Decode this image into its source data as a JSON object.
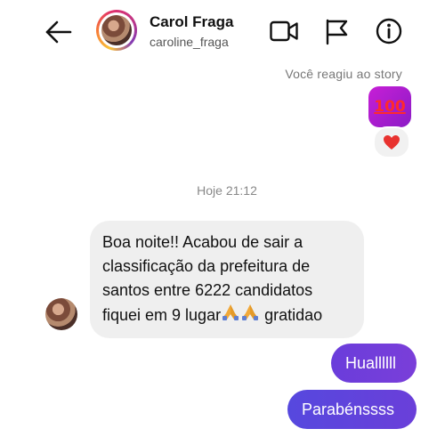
{
  "header": {
    "contact_name": "Carol Fraga",
    "contact_handle": "caroline_fraga",
    "icons": [
      "back-arrow-icon",
      "video-call-icon",
      "flag-icon",
      "info-icon"
    ]
  },
  "story_reply": {
    "note": "Você reagiu ao story",
    "story_thumbnail_emoji": "100",
    "reaction_emoji": "red-heart"
  },
  "thread": {
    "timestamp": "Hoje 21:12",
    "messages": [
      {
        "direction": "incoming",
        "lines": [
          "Boa noite!! Acabou de sair a",
          "classificação da prefeitura de",
          "santos entre 6222 candidatos",
          "fiquei em 9 lugar",
          "gratidao"
        ],
        "emojis": [
          "folded-hands",
          "folded-hands"
        ]
      },
      {
        "direction": "outgoing",
        "text": "Huallllll"
      },
      {
        "direction": "outgoing",
        "text": "Parabénssss"
      }
    ]
  },
  "colors": {
    "outgoing_bubble": "#5b3fdc",
    "incoming_bubble": "#efefef",
    "story_thumb": "#b91ed3"
  }
}
